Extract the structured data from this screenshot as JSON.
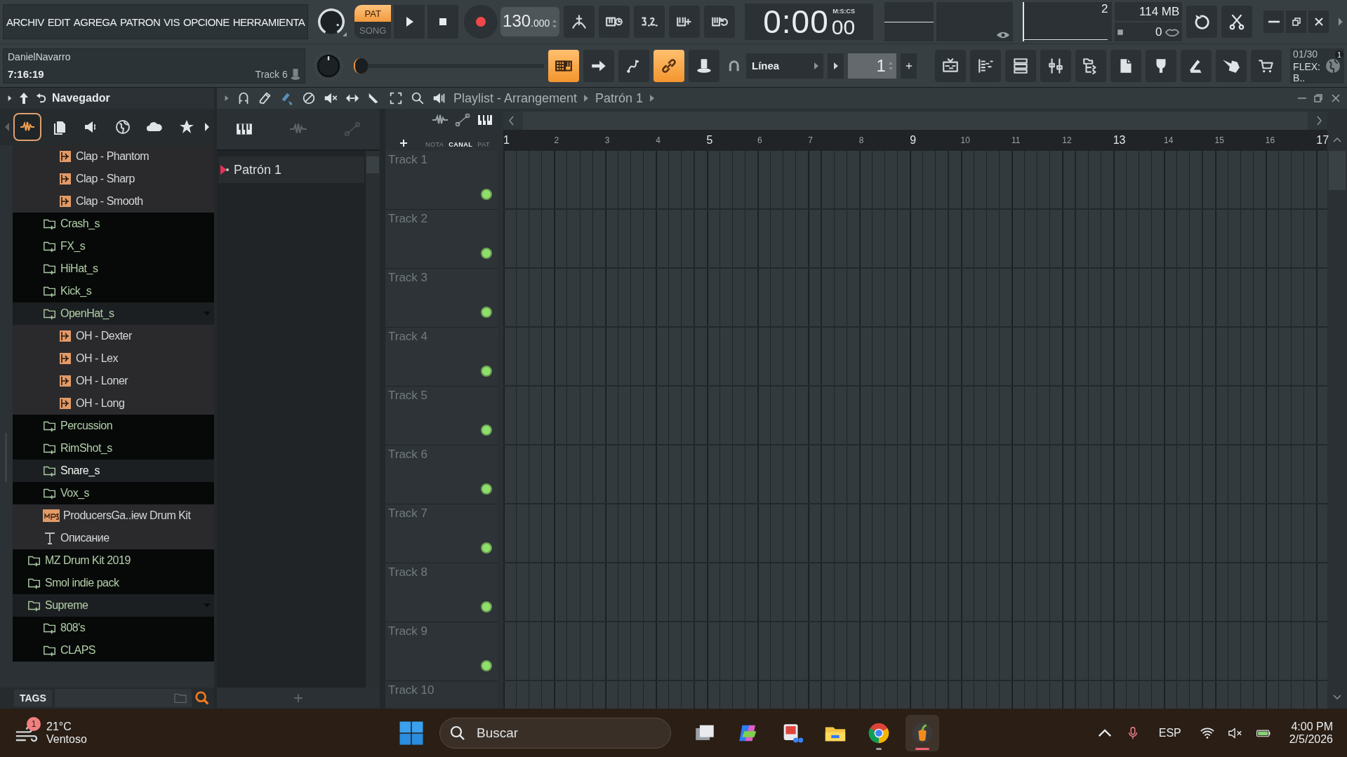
{
  "menu": [
    {
      "label": "ARCHIV"
    },
    {
      "label": "EDIT"
    },
    {
      "label": "AGREGA"
    },
    {
      "label": "PATRON"
    },
    {
      "label": "VIS"
    },
    {
      "label": "OPCIONE"
    },
    {
      "label": "HERRAMIENTA"
    }
  ],
  "hint": {
    "user": "DanielNavarro",
    "time": "7:16:19",
    "track": "Track 6"
  },
  "transport": {
    "modes": [
      {
        "label": "PAT",
        "selected": true
      },
      {
        "label": "SONG",
        "selected": false
      }
    ],
    "tempo": "130",
    "tempo_fraction": ".000"
  },
  "clock": {
    "time": "0:00",
    "centiseconds": "00",
    "format": "M:S:CS"
  },
  "monitor": {
    "polyphony": "2",
    "memory": "114 MB",
    "cpu": "0"
  },
  "master_pitch": {
    "level": 0
  },
  "toggles": [
    {
      "on": true
    },
    {
      "on": false
    },
    {
      "on": false
    },
    {
      "on": true
    },
    {
      "on": false
    }
  ],
  "snap": {
    "value": "Línea"
  },
  "pattern_selector": {
    "value": "1"
  },
  "news": {
    "count": "01/30",
    "title": "FLEX: B..",
    "badge": "1"
  },
  "browser": {
    "title": "Navegador",
    "tabs": [
      {
        "selected": true
      },
      {
        "selected": false
      },
      {
        "selected": false
      },
      {
        "selected": false
      },
      {
        "selected": false
      },
      {
        "selected": false
      }
    ],
    "tree": [
      {
        "kind": "offscreen",
        "children": [
          {
            "kind": "offscreen",
            "children": [
              {
                "label": "Clap - Phantom",
                "kind": "sample",
                "selected": false
              },
              {
                "label": "Clap - Sharp",
                "kind": "sample",
                "selected": false
              },
              {
                "label": "Clap - Smooth",
                "kind": "sample",
                "selected": false
              }
            ]
          },
          {
            "label": "Crash_s",
            "kind": "folder",
            "expanded": false,
            "selected": false
          },
          {
            "label": "FX_s",
            "kind": "folder",
            "expanded": false,
            "selected": false
          },
          {
            "label": "HiHat_s",
            "kind": "folder",
            "expanded": false,
            "selected": false
          },
          {
            "label": "Kick_s",
            "kind": "folder",
            "expanded": false,
            "selected": false
          },
          {
            "label": "OpenHat_s",
            "kind": "folder",
            "expanded": true,
            "selected": false,
            "children": [
              {
                "label": "OH - Dexter",
                "kind": "sample",
                "selected": false
              },
              {
                "label": "OH - Lex",
                "kind": "sample",
                "selected": false
              },
              {
                "label": "OH - Loner",
                "kind": "sample",
                "selected": false
              },
              {
                "label": "OH - Long",
                "kind": "sample",
                "selected": false
              }
            ]
          },
          {
            "label": "Percussion",
            "kind": "folder",
            "expanded": false,
            "selected": false
          },
          {
            "label": "RimShot_s",
            "kind": "folder",
            "expanded": false,
            "selected": false
          },
          {
            "label": "Snare_s",
            "kind": "folder",
            "expanded": false,
            "selected": true
          },
          {
            "label": "Vox_s",
            "kind": "folder",
            "expanded": false,
            "selected": false
          },
          {
            "label": "ProducersGa..iew Drum Kit",
            "kind": "mp3",
            "selected": false
          },
          {
            "label": "Описание",
            "kind": "text",
            "selected": false
          }
        ]
      },
      {
        "label": "MZ Drum Kit 2019",
        "kind": "folder",
        "expanded": false,
        "selected": false
      },
      {
        "label": "Smol indie pack",
        "kind": "folder",
        "expanded": false,
        "selected": false
      },
      {
        "label": "Supreme",
        "kind": "folder",
        "expanded": true,
        "selected": false,
        "children": [
          {
            "label": "808's",
            "kind": "folder",
            "expanded": false,
            "selected": false
          },
          {
            "label": "CLAPS",
            "kind": "folder",
            "expanded": false,
            "selected": false
          }
        ]
      }
    ],
    "tags_label": "TAGS"
  },
  "playlist": {
    "title": "Playlist - Arrangement",
    "pattern": "Patrón 1",
    "picker_tabs": [
      {
        "label": "NOTA",
        "selected": false
      },
      {
        "label": "CANAL",
        "selected": true
      },
      {
        "label": "PAT",
        "selected": false
      }
    ],
    "patterns": [
      {
        "label": "Patrón 1",
        "selected": true
      }
    ],
    "bars": [
      "1",
      "2",
      "3",
      "4",
      "5",
      "6",
      "7",
      "8",
      "9",
      "10",
      "11",
      "12",
      "13",
      "14",
      "15",
      "16",
      "17"
    ],
    "tracks": [
      {
        "label": "Track 1",
        "on": true
      },
      {
        "label": "Track 2",
        "on": true
      },
      {
        "label": "Track 3",
        "on": true
      },
      {
        "label": "Track 4",
        "on": true
      },
      {
        "label": "Track 5",
        "on": true
      },
      {
        "label": "Track 6",
        "on": true
      },
      {
        "label": "Track 7",
        "on": true
      },
      {
        "label": "Track 8",
        "on": true
      },
      {
        "label": "Track 9",
        "on": true
      },
      {
        "label": "Track 10"
      }
    ]
  },
  "taskbar": {
    "weather": {
      "temperature": "21°C",
      "condition": "Ventoso",
      "badge": "1"
    },
    "search": {
      "placeholder": "Buscar"
    },
    "apps": [
      {
        "running": false,
        "selected": false
      },
      {
        "running": false,
        "selected": false
      },
      {
        "running": false,
        "selected": false
      },
      {
        "running": false,
        "selected": false
      },
      {
        "running": true,
        "selected": false
      },
      {
        "running": true,
        "selected": true
      }
    ],
    "language": "ESP",
    "time": "4:00 PM",
    "date": "2/5/2026"
  }
}
